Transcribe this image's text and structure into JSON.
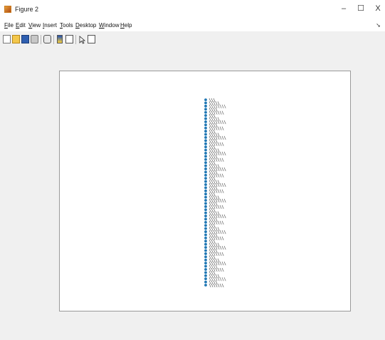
{
  "window": {
    "title": "Figure 2",
    "icon": "matlab-figure-icon",
    "controls": {
      "minimize": "–",
      "maximize": "☐",
      "close": "X"
    }
  },
  "menubar": {
    "items": [
      "File",
      "Edit",
      "View",
      "Insert",
      "Tools",
      "Desktop",
      "Window",
      "Help"
    ]
  },
  "toolbar": {
    "icons": [
      "new-figure-icon",
      "open-file-icon",
      "save-icon",
      "print-icon",
      "link-plot-icon",
      "insert-colorbar-icon",
      "insert-legend-icon",
      "select-arrow-icon",
      "property-inspector-icon"
    ]
  },
  "chart_data": {
    "type": "scatter",
    "marker_color": "#1f77b4",
    "point_count": 60,
    "label_count": 60,
    "note_labels": "dense overlapping rotated text labels beside a vertical column of points; individual label text is not legible"
  }
}
